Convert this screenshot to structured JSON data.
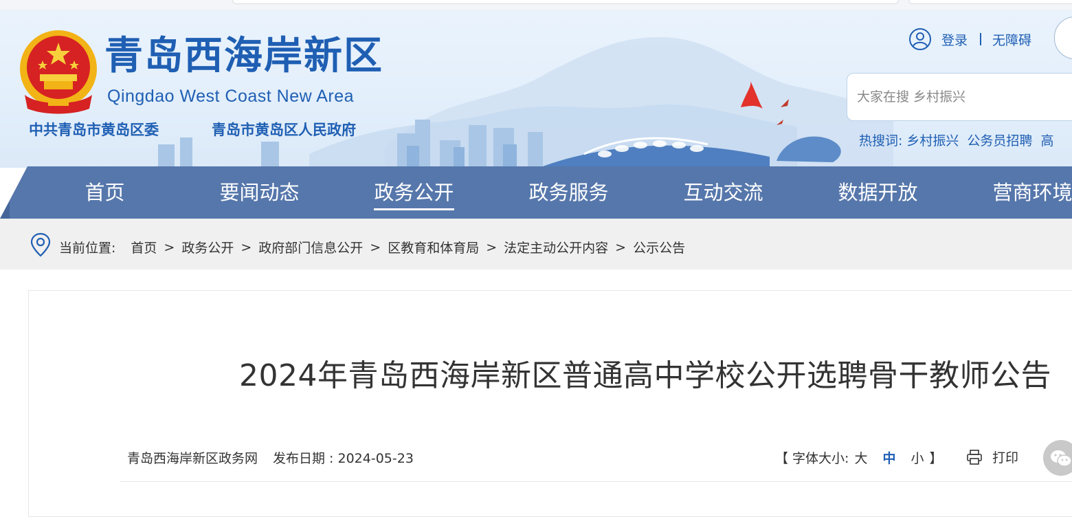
{
  "header": {
    "title": "青岛西海岸新区",
    "subtitle": "Qingdao West Coast New Area",
    "org_party": "中共青岛市黄岛区委",
    "org_gov": "青岛市黄岛区人民政府",
    "login": "登录",
    "accessibility": "无障碍",
    "search_placeholder": "大家在搜 乡村振兴",
    "hot_label": "热搜词:",
    "hot_words": [
      "乡村振兴",
      "公务员招聘",
      "高"
    ]
  },
  "nav": {
    "items": [
      "首页",
      "要闻动态",
      "政务公开",
      "政务服务",
      "互动交流",
      "数据开放",
      "营商环境"
    ],
    "active": "政务公开"
  },
  "breadcrumb": {
    "label": "当前位置:",
    "items": [
      "首页",
      "政务公开",
      "政府部门信息公开",
      "区教育和体育局",
      "法定主动公开内容",
      "公示公告"
    ],
    "separator": ">"
  },
  "article": {
    "title": "2024年青岛西海岸新区普通高中学校公开选聘骨干教师公告",
    "source": "青岛西海岸新区政务网",
    "date_label": "发布日期 : ",
    "date": "2024-05-23",
    "font_open": "【 字体大小:",
    "font_large": "大",
    "font_medium": "中",
    "font_small": "小",
    "font_close": "】",
    "print": "打印"
  },
  "colors": {
    "brand_blue": "#1f5fb3",
    "nav_bg": "#5677ab",
    "crumb_bg": "#f0f0f0"
  }
}
